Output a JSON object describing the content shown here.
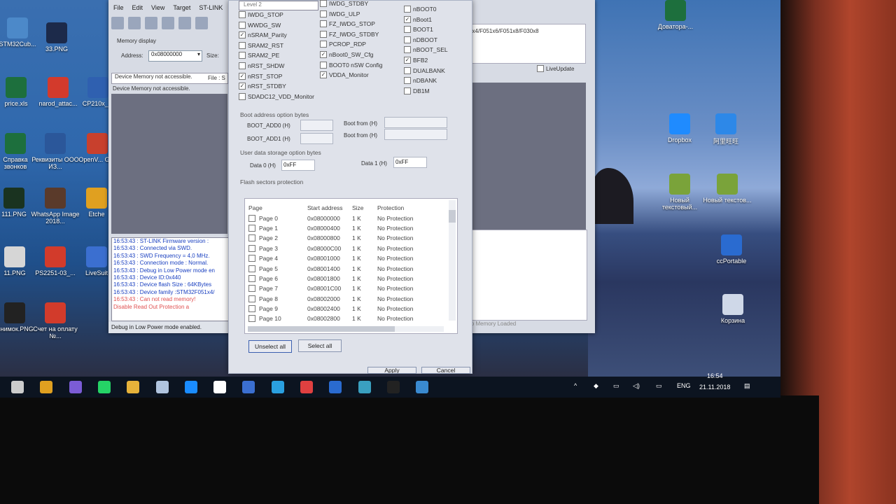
{
  "desktop_icons": [
    {
      "label": "STM32Cub...",
      "color": "#4c89c9"
    },
    {
      "label": "33.PNG",
      "color": "#1c2a4a"
    },
    {
      "label": "price.xls",
      "color": "#1d6f3d"
    },
    {
      "label": "narod_attac...",
      "color": "#d33a2c"
    },
    {
      "label": "CP210x_...",
      "color": "#2f60b0"
    },
    {
      "label": "Справка звонков",
      "color": "#1d6f3d"
    },
    {
      "label": "Реквизиты ООО ИЗ...",
      "color": "#2b579a"
    },
    {
      "label": "OpenV... GUI",
      "color": "#c8402d"
    },
    {
      "label": "111.PNG",
      "color": "#1a3320"
    },
    {
      "label": "WhatsApp Image 2018...",
      "color": "#5a3a2a"
    },
    {
      "label": "Etche",
      "color": "#e0a020"
    },
    {
      "label": "11.PNG",
      "color": "#d6d6d6"
    },
    {
      "label": "PS2251-03_...",
      "color": "#d23b2b"
    },
    {
      "label": "LiveSuit",
      "color": "#3b6fd0"
    },
    {
      "label": "Снимок.PNG",
      "color": "#222"
    },
    {
      "label": "Счет на оплату №...",
      "color": "#d23b2b"
    },
    {
      "label": "Доватора-...",
      "color": "#1d6f3d"
    },
    {
      "label": "Dropbox",
      "color": "#1f8bff"
    },
    {
      "label": "阿里旺旺",
      "color": "#2d88e8"
    },
    {
      "label": "Новый текстовый...",
      "color": "#7aa33a"
    },
    {
      "label": "Новый текстов...",
      "color": "#7aa33a"
    },
    {
      "label": "ccPortable",
      "color": "#2a6bd0"
    },
    {
      "label": "Корзина",
      "color": "#cfd8e8"
    }
  ],
  "stlink": {
    "menu": [
      "File",
      "Edit",
      "View",
      "Target",
      "ST-LINK"
    ],
    "memory_display_label": "Memory display",
    "address_label": "Address:",
    "address_value": "0x08000000",
    "size_label": "Size:",
    "error_msg": "Device Memory not accessible.",
    "file_label": "File : S",
    "error_msg2": "Device Memory not accessible.",
    "log": [
      {
        "text": "16:53:43 : ST-LINK Firmware version :",
        "color": "#1a40c0"
      },
      {
        "text": "16:53:43 : Connected via SWD.",
        "color": "#1a40c0"
      },
      {
        "text": "16:53:43 : SWD Frequency = 4,0 MHz.",
        "color": "#1a40c0"
      },
      {
        "text": "16:53:43 : Connection mode : Normal.",
        "color": "#1a40c0"
      },
      {
        "text": "16:53:43 : Debug in Low Power mode en",
        "color": "#1a40c0"
      },
      {
        "text": "16:53:43 : Device ID:0x440",
        "color": "#1a40c0"
      },
      {
        "text": "16:53:43 : Device flash Size : 64KBytes",
        "color": "#1a40c0"
      },
      {
        "text": "16:53:43 : Device family :STM32F051x4/",
        "color": "#1a40c0"
      },
      {
        "text": "16:53:43 : Can not read memory!",
        "color": "#e05050"
      },
      {
        "text": "             Disable Read Out Protection a",
        "color": "#e05050"
      }
    ],
    "status": "Debug in Low Power mode enabled.",
    "device_string": "1x4/F051x6/F051x8/F030x8",
    "live_update_label": "LiveUpdate",
    "no_memory": "No Memory Loaded"
  },
  "dialog": {
    "rdp_level": "Level 2",
    "col1": [
      {
        "label": "IWDG_STOP",
        "checked": false
      },
      {
        "label": "WWDG_SW",
        "checked": false
      },
      {
        "label": "nSRAM_Parity",
        "checked": true
      },
      {
        "label": "SRAM2_RST",
        "checked": false
      },
      {
        "label": "SRAM2_PE",
        "checked": false
      },
      {
        "label": "nRST_SHDW",
        "checked": false
      },
      {
        "label": "nRST_STOP",
        "checked": true
      },
      {
        "label": "nRST_STDBY",
        "checked": true
      },
      {
        "label": "SDADC12_VDD_Monitor",
        "checked": false
      }
    ],
    "col2": [
      {
        "label": "IWDG_STDBY",
        "checked": false
      },
      {
        "label": "IWDG_ULP",
        "checked": false
      },
      {
        "label": "FZ_IWDG_STOP",
        "checked": false
      },
      {
        "label": "FZ_IWDG_STDBY",
        "checked": false
      },
      {
        "label": "PCROP_RDP",
        "checked": false
      },
      {
        "label": "nBoot0_SW_Cfg",
        "checked": true
      },
      {
        "label": "BOOT0 nSW Config",
        "checked": false
      },
      {
        "label": "VDDA_Monitor",
        "checked": true
      }
    ],
    "col3": [
      {
        "label": "nBOOT0",
        "checked": false
      },
      {
        "label": "nBoot1",
        "checked": true
      },
      {
        "label": "BOOT1",
        "checked": false
      },
      {
        "label": "nDBOOT",
        "checked": false
      },
      {
        "label": "nBOOT_SEL",
        "checked": false
      },
      {
        "label": "BFB2",
        "checked": true
      },
      {
        "label": "DUALBANK",
        "checked": false
      },
      {
        "label": "nDBANK",
        "checked": false
      },
      {
        "label": "DB1M",
        "checked": false
      }
    ],
    "boot_group_title": "Boot address option bytes",
    "boot_add0": "BOOT_ADD0 (H)",
    "boot_add1": "BOOT_ADD1 (H)",
    "boot_from": "Boot from (H)",
    "user_group_title": "User data storage option bytes",
    "data0_label": "Data 0 (H)",
    "data0_value": "0xFF",
    "data1_label": "Data 1 (H)",
    "data1_value": "0xFF",
    "flash_group_title": "Flash sectors protection",
    "table_headers": [
      "Page",
      "Start address",
      "Size",
      "Protection"
    ],
    "pages": [
      {
        "page": "Page 0",
        "addr": "0x08000000",
        "size": "1 K",
        "prot": "No Protection"
      },
      {
        "page": "Page 1",
        "addr": "0x08000400",
        "size": "1 K",
        "prot": "No Protection"
      },
      {
        "page": "Page 2",
        "addr": "0x08000800",
        "size": "1 K",
        "prot": "No Protection"
      },
      {
        "page": "Page 3",
        "addr": "0x08000C00",
        "size": "1 K",
        "prot": "No Protection"
      },
      {
        "page": "Page 4",
        "addr": "0x08001000",
        "size": "1 K",
        "prot": "No Protection"
      },
      {
        "page": "Page 5",
        "addr": "0x08001400",
        "size": "1 K",
        "prot": "No Protection"
      },
      {
        "page": "Page 6",
        "addr": "0x08001800",
        "size": "1 K",
        "prot": "No Protection"
      },
      {
        "page": "Page 7",
        "addr": "0x08001C00",
        "size": "1 K",
        "prot": "No Protection"
      },
      {
        "page": "Page 8",
        "addr": "0x08002000",
        "size": "1 K",
        "prot": "No Protection"
      },
      {
        "page": "Page 9",
        "addr": "0x08002400",
        "size": "1 K",
        "prot": "No Protection"
      },
      {
        "page": "Page 10",
        "addr": "0x08002800",
        "size": "1 K",
        "prot": "No Protection"
      }
    ],
    "unselect_all": "Unselect all",
    "select_all": "Select all",
    "apply": "Apply",
    "cancel": "Cancel"
  },
  "taskbar": {
    "lang": "ENG",
    "time": "16:54",
    "date": "21.11.2018",
    "apps": [
      "task-view-icon",
      "chrome-icon",
      "viber-icon",
      "whatsapp-icon",
      "explorer-icon",
      "app-icon",
      "teamviewer-icon",
      "notes-icon",
      "save-icon",
      "browser-icon",
      "media-icon",
      "ssls-icon",
      "remote-icon",
      "terminal-icon",
      "stlink-icon"
    ]
  }
}
